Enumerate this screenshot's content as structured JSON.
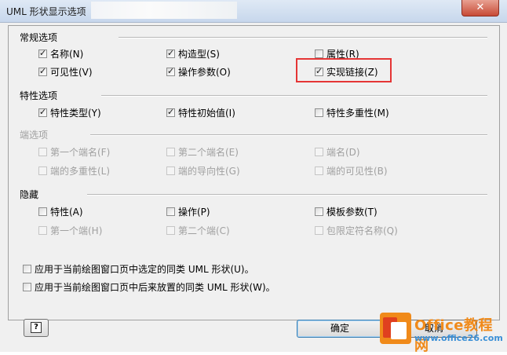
{
  "window": {
    "title": "UML 形状显示选项",
    "close_label": "✕"
  },
  "sections": {
    "general": {
      "title": "常规选项",
      "items": [
        {
          "label": "名称(N)",
          "checked": true,
          "enabled": true
        },
        {
          "label": "构造型(S)",
          "checked": true,
          "enabled": true
        },
        {
          "label": "属性(R)",
          "checked": false,
          "enabled": true
        },
        {
          "label": "可见性(V)",
          "checked": true,
          "enabled": true
        },
        {
          "label": "操作参数(O)",
          "checked": true,
          "enabled": true
        },
        {
          "label": "实现链接(Z)",
          "checked": true,
          "enabled": true
        }
      ]
    },
    "properties": {
      "title": "特性选项",
      "items": [
        {
          "label": "特性类型(Y)",
          "checked": true,
          "enabled": true
        },
        {
          "label": "特性初始值(I)",
          "checked": true,
          "enabled": true
        },
        {
          "label": "特性多重性(M)",
          "checked": false,
          "enabled": true
        }
      ]
    },
    "ends": {
      "title": "端选项",
      "items": [
        {
          "label": "第一个端名(F)",
          "checked": false,
          "enabled": false
        },
        {
          "label": "第二个端名(E)",
          "checked": false,
          "enabled": false
        },
        {
          "label": "端名(D)",
          "checked": false,
          "enabled": false
        },
        {
          "label": "端的多重性(L)",
          "checked": false,
          "enabled": false
        },
        {
          "label": "端的导向性(G)",
          "checked": false,
          "enabled": false
        },
        {
          "label": "端的可见性(B)",
          "checked": false,
          "enabled": false
        }
      ]
    },
    "hide": {
      "title": "隐藏",
      "items": [
        {
          "label": "特性(A)",
          "checked": false,
          "enabled": true
        },
        {
          "label": "操作(P)",
          "checked": false,
          "enabled": true
        },
        {
          "label": "模板参数(T)",
          "checked": false,
          "enabled": true
        },
        {
          "label": "第一个端(H)",
          "checked": false,
          "enabled": false
        },
        {
          "label": "第二个端(C)",
          "checked": false,
          "enabled": false
        },
        {
          "label": "包限定符名称(Q)",
          "checked": false,
          "enabled": false
        }
      ]
    }
  },
  "apply_options": [
    {
      "label": "应用于当前绘图窗口页中选定的同类 UML 形状(U)。",
      "checked": false
    },
    {
      "label": "应用于当前绘图窗口页中后来放置的同类 UML 形状(W)。",
      "checked": false
    }
  ],
  "buttons": {
    "help_label": "?",
    "ok_label": "确定",
    "cancel_label": "取消"
  },
  "watermark": {
    "text": "Office教程网",
    "url": "www.office26.com"
  },
  "colors": {
    "highlight": "#e53535",
    "accent": "#f08a1a"
  }
}
